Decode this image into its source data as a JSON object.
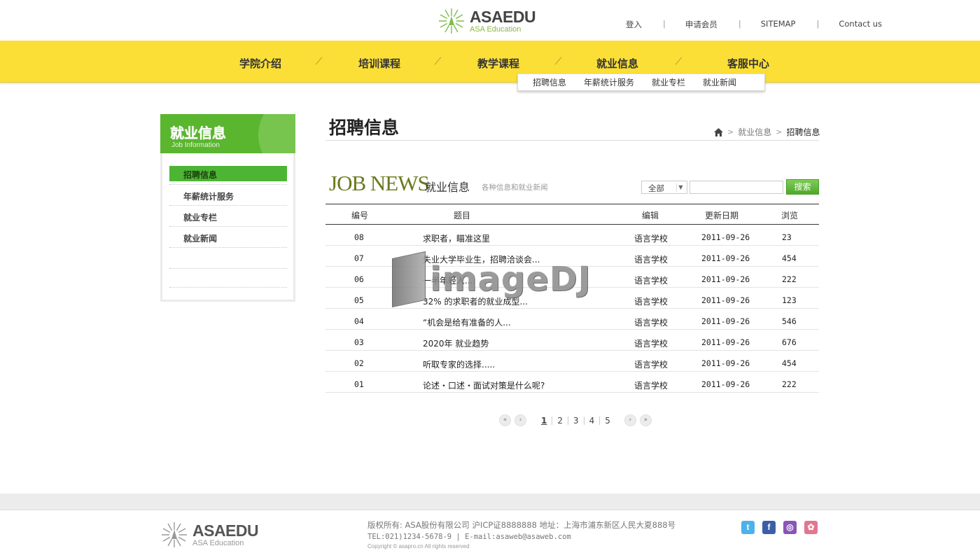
{
  "header": {
    "logo_name": "ASAEDU",
    "logo_sub": "ASA Education",
    "top_links": [
      "登入",
      "申请会员",
      "SITEMAP",
      "Contact us"
    ]
  },
  "nav": {
    "items": [
      "学院介绍",
      "培训课程",
      "教学课程",
      "就业信息",
      "客服中心"
    ],
    "submenu": [
      "招聘信息",
      "年薪统计服务",
      "就业专栏",
      "就业新闻"
    ]
  },
  "sidebar": {
    "title": "就业信息",
    "subtitle": "Job Information",
    "items": [
      "招聘信息",
      "年薪统计服务",
      "就业专栏",
      "就业新闻"
    ],
    "active_index": 0
  },
  "main": {
    "page_title": "招聘信息",
    "breadcrumb": [
      "就业信息",
      "招聘信息"
    ],
    "section_title_en": "JOB NEWS",
    "section_title_cn": "就业信息",
    "section_desc": "各种信息和就业新闻",
    "filter_selected": "全部",
    "search_value": "",
    "search_button": "搜索"
  },
  "table": {
    "headers": [
      "编号",
      "题目",
      "编辑",
      "更新日期",
      "浏览"
    ],
    "rows": [
      {
        "num": "08",
        "title": "求职者，瞄准这里",
        "editor": "语言学校",
        "date": "2011-09-26",
        "views": "23"
      },
      {
        "num": "07",
        "title": "失业大学毕业生，招聘洽谈会...",
        "editor": "语言学校",
        "date": "2011-09-26",
        "views": "454"
      },
      {
        "num": "06",
        "title": "一半年轻人...",
        "editor": "语言学校",
        "date": "2011-09-26",
        "views": "222"
      },
      {
        "num": "05",
        "title": "32% 的求职者的就业成型...",
        "editor": "语言学校",
        "date": "2011-09-26",
        "views": "123"
      },
      {
        "num": "04",
        "title": "“机会是给有准备的人...",
        "editor": "语言学校",
        "date": "2011-09-26",
        "views": "546"
      },
      {
        "num": "03",
        "title": "2020年 就业趋势",
        "editor": "语言学校",
        "date": "2011-09-26",
        "views": "676"
      },
      {
        "num": "02",
        "title": "听取专家的选择.....",
        "editor": "语言学校",
        "date": "2011-09-26",
        "views": "454"
      },
      {
        "num": "01",
        "title": "论述・口述・面试对策是什么呢?",
        "editor": "语言学校",
        "date": "2011-09-26",
        "views": "222"
      }
    ]
  },
  "pager": {
    "first": "«",
    "prev": "‹",
    "pages": [
      "1",
      "2",
      "3",
      "4",
      "5"
    ],
    "current": "1",
    "next": "›",
    "last": "»"
  },
  "watermark": "imageDJ",
  "footer": {
    "logo_name": "ASAEDU",
    "logo_sub": "ASA Education",
    "line1": "版权所有: ASA股份有限公司 沪ICP证8888888 地址：上海市浦东新区人民大夏888号",
    "line2": "TEL:021)1234-5678-9 | E-mail:asaweb@asaweb.com",
    "line3": "Copyright © asapro.cn All rights reserved",
    "social": [
      "twitter-icon",
      "facebook-icon",
      "podcast-icon",
      "flickr-icon"
    ]
  },
  "colors": {
    "nav_yellow": "#fbdf37",
    "brand_green": "#5ab52f",
    "active_green": "#4db534"
  }
}
